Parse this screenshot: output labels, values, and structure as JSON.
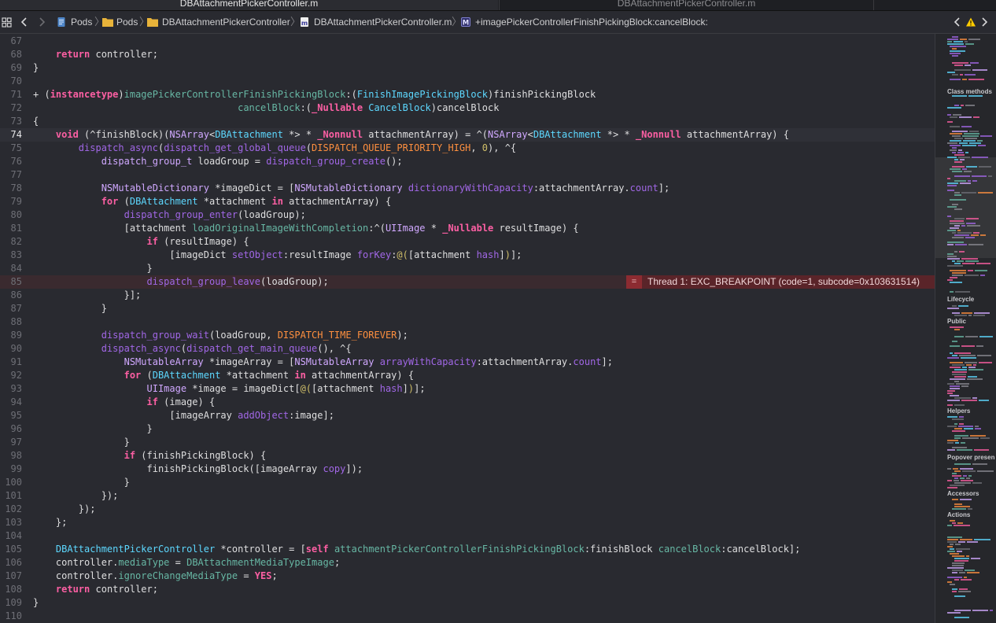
{
  "tabs": [
    {
      "label": "DBAttachmentPickerController.m",
      "active": true
    },
    {
      "label": "DBAttachmentPickerController.m",
      "active": false
    }
  ],
  "jumpbar": {
    "crumbs": [
      "Pods",
      "Pods",
      "DBAttachmentPickerController",
      "DBAttachmentPickerController.m",
      "+imagePickerControllerFinishPickingBlock:cancelBlock:"
    ],
    "method_badge": "M",
    "file_badge": "m"
  },
  "editor": {
    "current_line": 74,
    "error_line": 85,
    "error_message": "Thread 1: EXC_BREAKPOINT (code=1, subcode=0x103631514)",
    "error_badge_glyph": "=",
    "lines": [
      {
        "n": 67,
        "html": ""
      },
      {
        "n": 68,
        "html": "    <span class='k'>return</span> controller;"
      },
      {
        "n": 69,
        "html": "}"
      },
      {
        "n": 70,
        "html": ""
      },
      {
        "n": 71,
        "html": "+ (<span class='k'>instancetype</span>)<span class='mt'>imagePickerControllerFinishPickingBlock</span>:(<span class='t'>FinishImagePickingBlock</span>)finishPickingBlock"
      },
      {
        "n": 72,
        "html": "                                    <span class='mt'>cancelBlock</span>:(<span class='k'>_Nullable</span> <span class='t'>CancelBlock</span>)cancelBlock"
      },
      {
        "n": 73,
        "html": "{"
      },
      {
        "n": 74,
        "html": "    <span class='k'>void</span> (^finishBlock)(<span class='cl'>NSArray</span>&lt;<span class='t'>DBAttachment</span> *&gt; * <span class='k'>_Nonnull</span> attachmentArray) = ^(<span class='cl'>NSArray</span>&lt;<span class='t'>DBAttachment</span> *&gt; * <span class='k'>_Nonnull</span> attachmentArray) {"
      },
      {
        "n": 75,
        "html": "        <span class='fx'>dispatch_async</span>(<span class='fx'>dispatch_get_global_queue</span>(<span class='mc'>DISPATCH_QUEUE_PRIORITY_HIGH</span>, <span class='num'>0</span>), ^{"
      },
      {
        "n": 76,
        "html": "            <span class='cl'>dispatch_group_t</span> loadGroup = <span class='fx'>dispatch_group_create</span>();"
      },
      {
        "n": 77,
        "html": ""
      },
      {
        "n": 78,
        "html": "            <span class='cl'>NSMutableDictionary</span> *imageDict = [<span class='cl'>NSMutableDictionary</span> <span class='fn'>dictionaryWithCapacity</span>:attachmentArray.<span class='fn'>count</span>];"
      },
      {
        "n": 79,
        "html": "            <span class='k'>for</span> (<span class='t'>DBAttachment</span> *attachment <span class='k'>in</span> attachmentArray) {"
      },
      {
        "n": 80,
        "html": "                <span class='fx'>dispatch_group_enter</span>(loadGroup);"
      },
      {
        "n": 81,
        "html": "                [attachment <span class='mt'>loadOriginalImageWithCompletion</span>:^(<span class='cl'>UIImage</span> * <span class='k'>_Nullable</span> resultImage) {"
      },
      {
        "n": 82,
        "html": "                    <span class='k'>if</span> (resultImage) {"
      },
      {
        "n": 83,
        "html": "                        [imageDict <span class='fn'>setObject</span>:resultImage <span class='fn'>forKey</span>:<span class='num'>@(</span>[attachment <span class='fn'>hash</span>]<span class='num'>)</span>];"
      },
      {
        "n": 84,
        "html": "                    }"
      },
      {
        "n": 85,
        "html": "                    <span class='fx'>dispatch_group_leave</span>(loadGroup);"
      },
      {
        "n": 86,
        "html": "                }];"
      },
      {
        "n": 87,
        "html": "            }"
      },
      {
        "n": 88,
        "html": ""
      },
      {
        "n": 89,
        "html": "            <span class='fx'>dispatch_group_wait</span>(loadGroup, <span class='mc'>DISPATCH_TIME_FOREVER</span>);"
      },
      {
        "n": 90,
        "html": "            <span class='fx'>dispatch_async</span>(<span class='fx'>dispatch_get_main_queue</span>(), ^{"
      },
      {
        "n": 91,
        "html": "                <span class='cl'>NSMutableArray</span> *imageArray = [<span class='cl'>NSMutableArray</span> <span class='fn'>arrayWithCapacity</span>:attachmentArray.<span class='fn'>count</span>];"
      },
      {
        "n": 92,
        "html": "                <span class='k'>for</span> (<span class='t'>DBAttachment</span> *attachment <span class='k'>in</span> attachmentArray) {"
      },
      {
        "n": 93,
        "html": "                    <span class='cl'>UIImage</span> *image = imageDict[<span class='num'>@(</span>[attachment <span class='fn'>hash</span>]<span class='num'>)</span>];"
      },
      {
        "n": 94,
        "html": "                    <span class='k'>if</span> (image) {"
      },
      {
        "n": 95,
        "html": "                        [imageArray <span class='fn'>addObject</span>:image];"
      },
      {
        "n": 96,
        "html": "                    }"
      },
      {
        "n": 97,
        "html": "                }"
      },
      {
        "n": 98,
        "html": "                <span class='k'>if</span> (finishPickingBlock) {"
      },
      {
        "n": 99,
        "html": "                    finishPickingBlock([imageArray <span class='fn'>copy</span>]);"
      },
      {
        "n": 100,
        "html": "                }"
      },
      {
        "n": 101,
        "html": "            });"
      },
      {
        "n": 102,
        "html": "        });"
      },
      {
        "n": 103,
        "html": "    };"
      },
      {
        "n": 104,
        "html": ""
      },
      {
        "n": 105,
        "html": "    <span class='t'>DBAttachmentPickerController</span> *controller = [<span class='k'>self</span> <span class='mt'>attachmentPickerControllerFinishPickingBlock</span>:finishBlock <span class='mt'>cancelBlock</span>:cancelBlock];"
      },
      {
        "n": 106,
        "html": "    controller.<span class='mt'>mediaType</span> = <span class='mt'>DBAttachmentMediaTypeImage</span>;"
      },
      {
        "n": 107,
        "html": "    controller.<span class='mt'>ignoreChangeMediaType</span> = <span class='k'>YES</span>;"
      },
      {
        "n": 108,
        "html": "    <span class='k'>return</span> controller;"
      },
      {
        "n": 109,
        "html": "}"
      },
      {
        "n": 110,
        "html": ""
      }
    ]
  },
  "minimap": {
    "headings": [
      "Class methods",
      "Lifecycle",
      "Public",
      "Helpers",
      "Popover presen",
      "Accessors",
      "Actions"
    ]
  },
  "colors": {
    "background": "#292a30",
    "keyword": "#fc5fa3",
    "type": "#5dd8ff",
    "error_bg": "#5a2429",
    "warning": "#ffcc00"
  }
}
